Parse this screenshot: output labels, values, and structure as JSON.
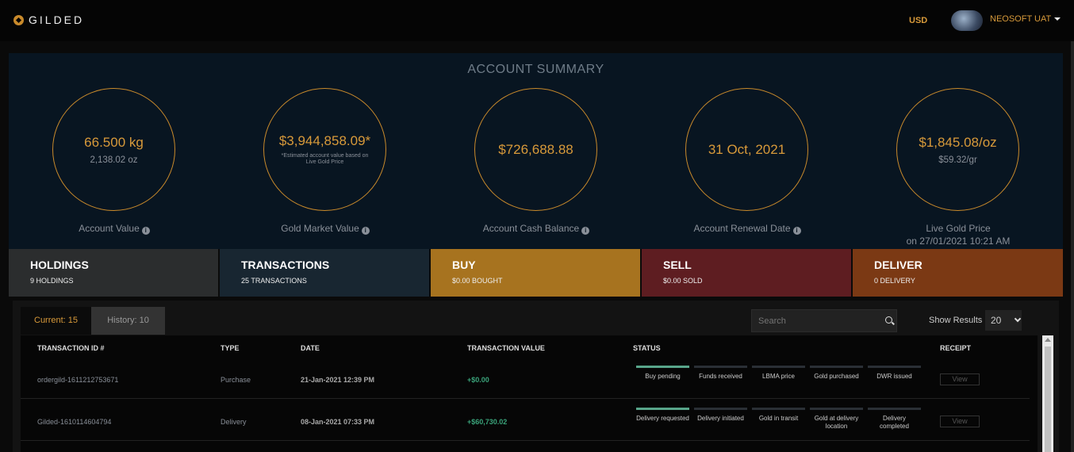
{
  "header": {
    "logo_text": "GILDED",
    "currency": "USD",
    "user_name": "NEOSOFT UAT"
  },
  "summary": {
    "title": "ACCOUNT SUMMARY",
    "metrics": [
      {
        "value": "66.500 kg",
        "sub": "2,138.02 oz",
        "note": "",
        "label": "Account Value",
        "info": true
      },
      {
        "value": "$3,944,858.09*",
        "sub": "",
        "note": "*Estimated account value based on Live Gold Price",
        "label": "Gold Market Value",
        "info": true
      },
      {
        "value": "$726,688.88",
        "sub": "",
        "note": "",
        "label": "Account Cash Balance",
        "info": true
      },
      {
        "value": "31 Oct, 2021",
        "sub": "",
        "note": "",
        "label": "Account Renewal Date",
        "info": true
      },
      {
        "value": "$1,845.08/oz",
        "sub": "$59.32/gr",
        "note": "",
        "label": "Live Gold Price",
        "label2": "on 27/01/2021 10:21 AM",
        "info": false
      }
    ]
  },
  "tiles": [
    {
      "title": "HOLDINGS",
      "sub": "9 HOLDINGS",
      "color": "#2b2d2e"
    },
    {
      "title": "TRANSACTIONS",
      "sub": "25 TRANSACTIONS",
      "color": "#182631"
    },
    {
      "title": "BUY",
      "sub": "$0.00 BOUGHT",
      "color": "#a7731f"
    },
    {
      "title": "SELL",
      "sub": "$0.00 SOLD",
      "color": "#5e1d21"
    },
    {
      "title": "DELIVER",
      "sub": "0 DELIVERY",
      "color": "#7b3914"
    }
  ],
  "transactions": {
    "tab_current": "Current: 15",
    "tab_history": "History: 10",
    "search_placeholder": "Search",
    "show_results_label": "Show Results",
    "show_results_value": "20",
    "columns": [
      "TRANSACTION ID #",
      "TYPE",
      "DATE",
      "TRANSACTION VALUE",
      "STATUS",
      "RECEIPT"
    ],
    "rows": [
      {
        "id": "ordergild-1611212753671",
        "type": "Purchase",
        "date": "21-Jan-2021 12:39 PM",
        "value": "+$0.00",
        "steps": [
          "Buy pending",
          "Funds received",
          "LBMA price",
          "Gold purchased",
          "DWR issued"
        ],
        "active_steps": 1,
        "receipt": "View"
      },
      {
        "id": "Gilded-1610114604794",
        "type": "Delivery",
        "date": "08-Jan-2021 07:33 PM",
        "value": "+$60,730.02",
        "steps": [
          "Delivery requested",
          "Delivery initiated",
          "Gold in transit",
          "Gold at delivery location",
          "Delivery completed"
        ],
        "active_steps": 1,
        "receipt": "View"
      }
    ]
  },
  "colors": {
    "accent": "#d89a3a",
    "positive": "#3aa37a",
    "status_active": "#58a58a"
  }
}
